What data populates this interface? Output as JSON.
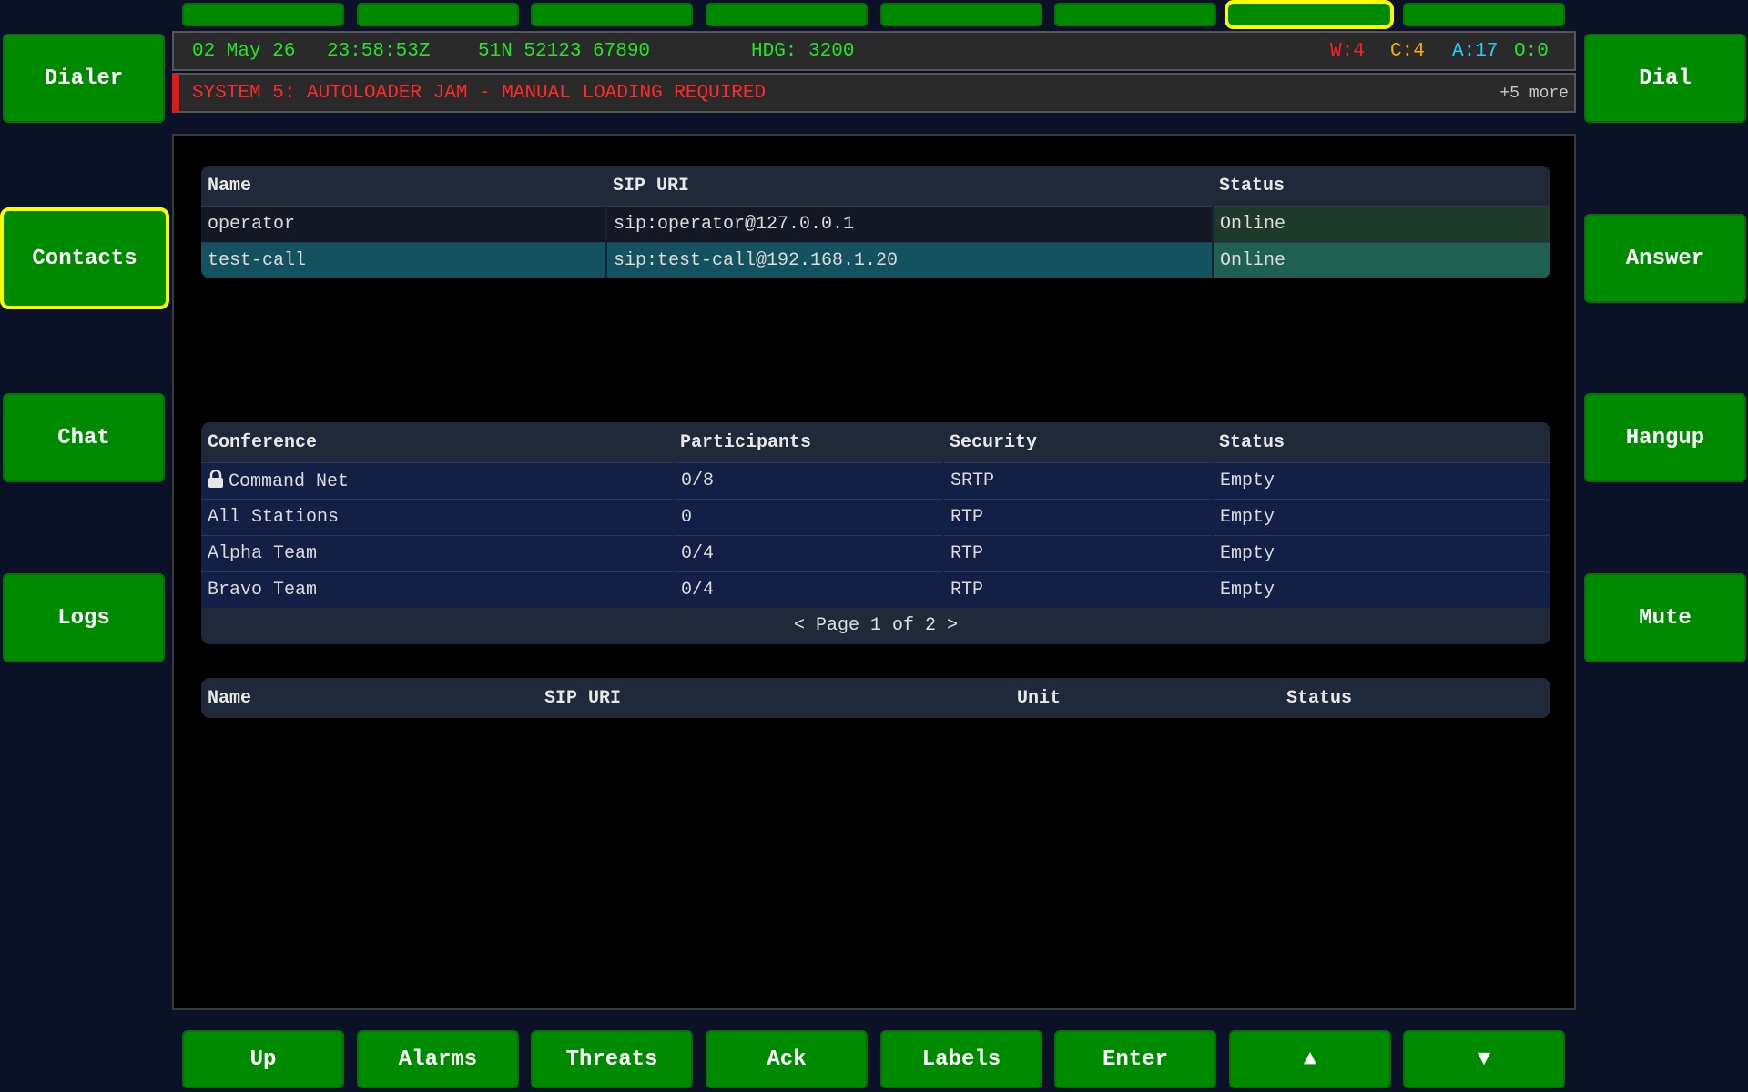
{
  "top_buttons": [
    "",
    "",
    "",
    "",
    "",
    "",
    "",
    ""
  ],
  "top_selected_index": 6,
  "left_nav": [
    {
      "label": "Dialer"
    },
    {
      "label": "Contacts"
    },
    {
      "label": "Chat"
    },
    {
      "label": "Logs"
    }
  ],
  "left_selected_index": 1,
  "right_actions": [
    {
      "label": "Dial"
    },
    {
      "label": "Answer"
    },
    {
      "label": "Hangup"
    },
    {
      "label": "Mute"
    }
  ],
  "bottom_buttons": [
    {
      "label": "Up"
    },
    {
      "label": "Alarms"
    },
    {
      "label": "Threats"
    },
    {
      "label": "Ack"
    },
    {
      "label": "Labels"
    },
    {
      "label": "Enter"
    },
    {
      "label": "▲"
    },
    {
      "label": "▼"
    }
  ],
  "status": {
    "date": "02 May 26",
    "time": "23:58:53Z",
    "position": "51N 52123 67890",
    "heading": "HDG: 3200",
    "counts": {
      "w": "W:4",
      "c": "C:4",
      "a": "A:17",
      "o": "O:0"
    },
    "colors": {
      "w": "#ff2020",
      "c": "#ffaa00",
      "a": "#22ccff",
      "o": "#22e822"
    }
  },
  "alert": {
    "text": "SYSTEM 5: AUTOLOADER JAM - MANUAL LOADING REQUIRED",
    "more": "+5 more"
  },
  "contacts": {
    "headers": [
      "Name",
      "SIP URI",
      "Status"
    ],
    "rows": [
      {
        "name": "operator",
        "uri": "sip:operator@127.0.0.1",
        "status": "Online"
      },
      {
        "name": "test-call",
        "uri": "sip:test-call@192.168.1.20",
        "status": "Online"
      }
    ]
  },
  "conferences": {
    "headers": [
      "Conference",
      "Participants",
      "Security",
      "Status"
    ],
    "rows": [
      {
        "name": "Command Net",
        "participants": "0/8",
        "security": "SRTP",
        "status": "Empty"
      },
      {
        "name": "All Stations",
        "participants": "0",
        "security": "RTP",
        "status": "Empty"
      },
      {
        "name": "Alpha Team",
        "participants": "0/4",
        "security": "RTP",
        "status": "Empty"
      },
      {
        "name": "Bravo Team",
        "participants": "0/4",
        "security": "RTP",
        "status": "Empty"
      }
    ],
    "pager": "< Page 1 of 2 >"
  },
  "units": {
    "headers": [
      "Name",
      "SIP URI",
      "Unit",
      "Status"
    ]
  }
}
